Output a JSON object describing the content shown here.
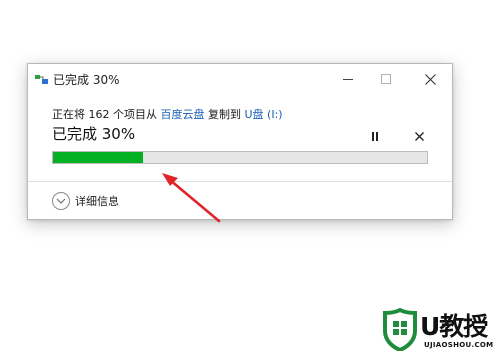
{
  "window": {
    "title": "已完成 30%",
    "icons": {
      "app": "copy-transfer-icon",
      "minimize": "minimize-icon",
      "maximize": "maximize-icon",
      "close": "close-icon"
    }
  },
  "copy": {
    "prefix": "正在将 162 个项目从 ",
    "source": "百度云盘",
    "middle": " 复制到 ",
    "destination": "U盘 (I:)",
    "percent_heading": "已完成 30%",
    "progress_fraction": 0.24,
    "progress_color": "#06b025",
    "link_color": "#1a5fb4"
  },
  "controls": {
    "pause_icon": "pause-icon",
    "cancel_icon": "cancel-icon"
  },
  "details": {
    "label": "详细信息",
    "icon": "chevron-down-circle-icon"
  },
  "annotation": {
    "arrow_color": "#e0242a"
  },
  "watermark": {
    "brand_text": "U教授",
    "domain": "UJIAOSHOU.COM",
    "logo_color": "#1e8c3a"
  }
}
